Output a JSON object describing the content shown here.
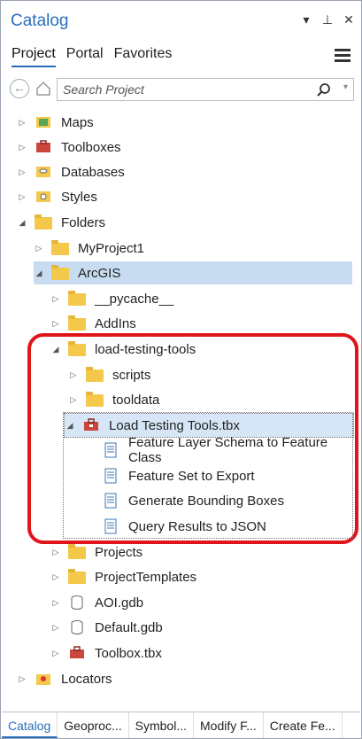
{
  "window": {
    "title": "Catalog",
    "controls": {
      "menu": "▾",
      "pin": "⊥",
      "close": "✕"
    }
  },
  "tabs": [
    "Project",
    "Portal",
    "Favorites"
  ],
  "search": {
    "placeholder": "Search Project"
  },
  "tree": [
    {
      "label": "Maps",
      "icon": "maps-icon"
    },
    {
      "label": "Toolboxes",
      "icon": "toolbox-icon"
    },
    {
      "label": "Databases",
      "icon": "database-icon"
    },
    {
      "label": "Styles",
      "icon": "styles-icon"
    },
    {
      "label": "Folders",
      "icon": "folder-icon"
    },
    {
      "label": "MyProject1",
      "icon": "home-folder-icon"
    },
    {
      "label": "ArcGIS",
      "icon": "folder-icon"
    },
    {
      "label": "__pycache__",
      "icon": "folder-icon"
    },
    {
      "label": "AddIns",
      "icon": "folder-icon"
    },
    {
      "label": "load-testing-tools",
      "icon": "folder-icon"
    },
    {
      "label": "scripts",
      "icon": "folder-icon"
    },
    {
      "label": "tooldata",
      "icon": "folder-icon"
    },
    {
      "label": "Load Testing Tools.tbx",
      "icon": "toolbox-icon"
    },
    {
      "label": "Feature Layer Schema to Feature Class",
      "icon": "script-tool-icon"
    },
    {
      "label": "Feature Set to Export",
      "icon": "script-tool-icon"
    },
    {
      "label": "Generate Bounding Boxes",
      "icon": "script-tool-icon"
    },
    {
      "label": "Query Results to JSON",
      "icon": "script-tool-icon"
    },
    {
      "label": "Projects",
      "icon": "folder-icon"
    },
    {
      "label": "ProjectTemplates",
      "icon": "folder-icon"
    },
    {
      "label": "AOI.gdb",
      "icon": "geodatabase-icon"
    },
    {
      "label": "Default.gdb",
      "icon": "geodatabase-icon"
    },
    {
      "label": "Toolbox.tbx",
      "icon": "toolbox-icon"
    },
    {
      "label": "Locators",
      "icon": "locator-icon"
    }
  ],
  "bottom_tabs": [
    "Catalog",
    "Geoproc...",
    "Symbol...",
    "Modify F...",
    "Create Fe..."
  ],
  "colors": {
    "accent": "#2a6ebb",
    "highlight": "#e0141b",
    "selection": "#c7dcf1"
  }
}
